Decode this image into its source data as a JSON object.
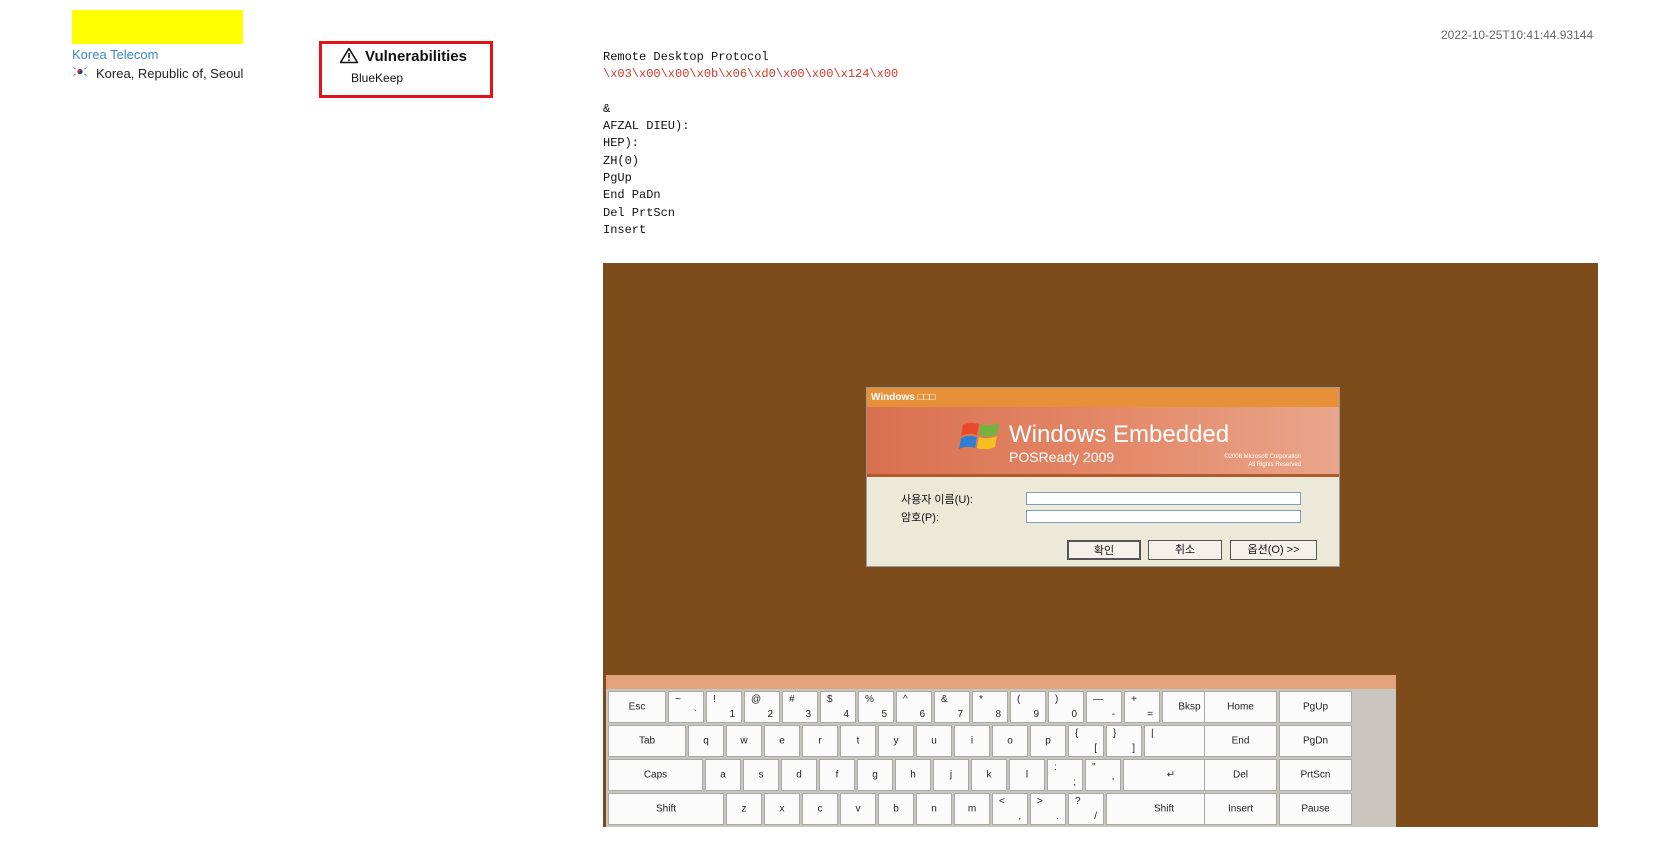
{
  "host": {
    "org": "Korea Telecom",
    "location": "Korea, Republic of, Seoul",
    "timestamp": "2022-10-25T10:41:44.93144"
  },
  "vulnerabilities": {
    "title": "Vulnerabilities",
    "items": [
      "BlueKeep"
    ]
  },
  "banner": {
    "lines": [
      {
        "text": "Remote Desktop Protocol",
        "red": false
      },
      {
        "text": "\\x03\\x00\\x00\\x0b\\x06\\xd0\\x00\\x00\\x124\\x00",
        "red": true
      },
      {
        "text": "",
        "red": false
      },
      {
        "text": "&",
        "red": false
      },
      {
        "text": "AFZAL DIEU):",
        "red": false
      },
      {
        "text": "HEP):",
        "red": false
      },
      {
        "text": "ZH(0)",
        "red": false
      },
      {
        "text": "PgUp",
        "red": false
      },
      {
        "text": "End PaDn",
        "red": false
      },
      {
        "text": "Del PrtScn",
        "red": false
      },
      {
        "text": "Insert",
        "red": false
      }
    ]
  },
  "screenshot": {
    "dialog": {
      "title": "Windows □□□",
      "brand": "Windows Embedded",
      "subbrand": "POSReady 2009",
      "copyright1": "©2008 Microsoft Corporation",
      "copyright2": "All Rights Reserved",
      "user_label": "사용자 이름(U):",
      "pass_label": "암호(P):",
      "ok": "확인",
      "cancel": "취소",
      "options": "옵션(O) >>"
    },
    "keyboard": {
      "rows": [
        [
          [
            "Esc"
          ],
          [
            "~",
            "`"
          ],
          [
            "!",
            "1"
          ],
          [
            "@",
            "2"
          ],
          [
            "#",
            "3"
          ],
          [
            "$",
            "4"
          ],
          [
            "%",
            "5"
          ],
          [
            "^",
            "6"
          ],
          [
            "&",
            "7"
          ],
          [
            "*",
            "8"
          ],
          [
            "(",
            "9"
          ],
          [
            ")",
            "0"
          ],
          [
            "—",
            "-"
          ],
          [
            "+",
            "="
          ],
          [
            "Bksp"
          ]
        ],
        [
          [
            "Tab"
          ],
          [
            "q"
          ],
          [
            "w"
          ],
          [
            "e"
          ],
          [
            "r"
          ],
          [
            "t"
          ],
          [
            "y"
          ],
          [
            "u"
          ],
          [
            "i"
          ],
          [
            "o"
          ],
          [
            "p"
          ],
          [
            "{",
            "["
          ],
          [
            "}",
            "]"
          ],
          [
            "|",
            "\\"
          ]
        ],
        [
          [
            "Caps"
          ],
          [
            "a"
          ],
          [
            "s"
          ],
          [
            "d"
          ],
          [
            "f"
          ],
          [
            "g"
          ],
          [
            "h"
          ],
          [
            "j"
          ],
          [
            "k"
          ],
          [
            "l"
          ],
          [
            ":",
            ";"
          ],
          [
            "\"",
            "'"
          ],
          [
            "↵"
          ]
        ],
        [
          [
            "Shift"
          ],
          [
            "z"
          ],
          [
            "x"
          ],
          [
            "c"
          ],
          [
            "v"
          ],
          [
            "b"
          ],
          [
            "n"
          ],
          [
            "m"
          ],
          [
            "<",
            ","
          ],
          [
            ">",
            "."
          ],
          [
            "?",
            "/"
          ],
          [
            "Shift"
          ]
        ]
      ],
      "nav": [
        [
          "Home",
          "PgUp"
        ],
        [
          "End",
          "PgDn"
        ],
        [
          "Del",
          "PrtScn"
        ],
        [
          "Insert",
          "Pause"
        ]
      ]
    }
  },
  "colors": {
    "highlight": "#ffff00",
    "vuln_border": "#e4131a",
    "banner_red": "#d03b2c",
    "screenshot_bg": "#7e4b1a"
  }
}
